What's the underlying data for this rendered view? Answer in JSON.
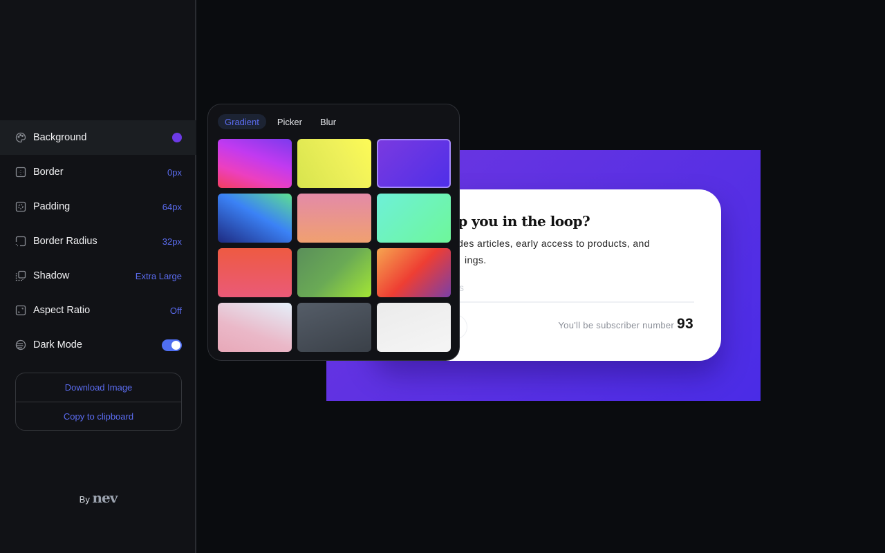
{
  "sidebar": {
    "items": [
      {
        "label": "Background",
        "value": "",
        "icon": "palette-icon",
        "swatch": "#6d3ae6"
      },
      {
        "label": "Border",
        "value": "0px",
        "icon": "border-icon"
      },
      {
        "label": "Padding",
        "value": "64px",
        "icon": "padding-icon"
      },
      {
        "label": "Border Radius",
        "value": "32px",
        "icon": "border-radius-icon"
      },
      {
        "label": "Shadow",
        "value": "Extra Large",
        "icon": "shadow-icon"
      },
      {
        "label": "Aspect Ratio",
        "value": "Off",
        "icon": "aspect-ratio-icon"
      },
      {
        "label": "Dark Mode",
        "value": "",
        "icon": "dark-mode-icon",
        "toggle": true
      }
    ],
    "download_label": "Download Image",
    "copy_label": "Copy to clipboard",
    "by_label": "By",
    "brand": "nev"
  },
  "popover": {
    "tabs": [
      "Gradient",
      "Picker",
      "Blur"
    ],
    "active_tab": "Gradient",
    "swatches": [
      "linear-gradient(20deg,#f43f5e 0%,#ec3fc0 30%,#c23af0 60%,#7c3aed 100%)",
      "linear-gradient(60deg,#d7e44e,#eef05a 60%,#fdfb57)",
      "linear-gradient(135deg,#7a3ae0,#4f2fe8)",
      "linear-gradient(30deg,#1e2a80,#3b82f6 55%,#5ee08f)",
      "linear-gradient(180deg,#e38aa8,#f0a070)",
      "linear-gradient(135deg,#6ef0d8,#6ef79a)",
      "linear-gradient(180deg,#ee5a42,#ea5a78)",
      "linear-gradient(135deg,#5a8f5a,#6aaa55 50%,#a3e635)",
      "linear-gradient(135deg,#f6a550,#ee3e33 50%,#7a3fa8)",
      "linear-gradient(200deg,#e4f0fa,#eab8c8 60%,#e8a8b8)",
      "linear-gradient(160deg,#555d68,#3a4048)",
      "linear-gradient(160deg,#ebebeb,#f5f5f5)"
    ],
    "selected_index": 2,
    "selected_border": "#a78bfa"
  },
  "preview": {
    "heading_visible": "ep you in the loop?",
    "line1_visible": "des articles, early access to products, and",
    "line2_visible": "ings.",
    "input_placeholder_visible": "s",
    "subscriber_label": "You'll be subscriber number",
    "subscriber_number": "93"
  },
  "colors": {
    "accent": "#5b6cf0",
    "background_gradient": [
      "#6e36e0",
      "#4a2ce6"
    ]
  }
}
